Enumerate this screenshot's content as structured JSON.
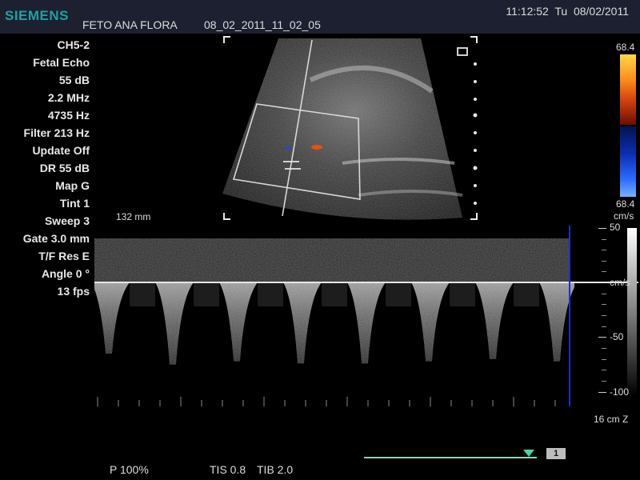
{
  "header": {
    "brand": "SIEMENS",
    "patient_name": "FETO ANA FLORA",
    "study_id": "08_02_2011_11_02_05",
    "time": "11:12:52",
    "weekday": "Tu",
    "date": "08/02/2011"
  },
  "parameters": [
    "CH5-2",
    "Fetal Echo",
    "55 dB",
    "2.2 MHz",
    "4735 Hz",
    "Filter 213 Hz",
    "Update Off",
    "DR 55 dB",
    "Map G",
    "Tint 1",
    "Sweep 3",
    "Gate 3.0 mm",
    "T/F Res E",
    "Angle 0 °",
    "13 fps"
  ],
  "bmode": {
    "depth_label": "132 mm",
    "gate_icon": "doppler-gate-icon"
  },
  "color_scale": {
    "max": "68.4",
    "min": "68.4",
    "unit": "cm/s",
    "positive_colors": [
      "#ffd84a",
      "#ff8f1a",
      "#d2420e",
      "#6a0e02"
    ],
    "negative_colors": [
      "#04144e",
      "#0b2fb3",
      "#2a6cff",
      "#77b0ff"
    ]
  },
  "doppler": {
    "scale_top": "50",
    "scale_unit": "cm/s",
    "scale_mid": "-50",
    "scale_bottom": "-100",
    "depth_z": "16 cm Z",
    "baseline_velocity": 0,
    "waveform_peaks": [
      -65,
      -75,
      -72,
      -74,
      -74,
      -72,
      -70,
      -72
    ],
    "sweep_color": "#1f2bd6"
  },
  "footer": {
    "power": "P 100%",
    "tis": "TIS 0.8",
    "tib": "TIB 2.0",
    "page": "1"
  }
}
